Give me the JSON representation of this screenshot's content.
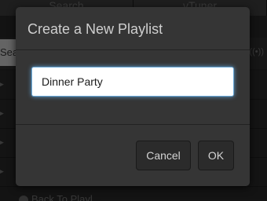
{
  "background": {
    "tabs": [
      "Search",
      "vTuner"
    ],
    "search_placeholder": "Sea",
    "back_link": "Back To Playl"
  },
  "dialog": {
    "title": "Create a New Playlist",
    "playlist_name_value": "Dinner Party",
    "cancel_label": "Cancel",
    "ok_label": "OK"
  },
  "colors": {
    "dialog_bg": "#353535",
    "input_focus": "#66afe9",
    "button_bg": "#2b2b2b"
  }
}
